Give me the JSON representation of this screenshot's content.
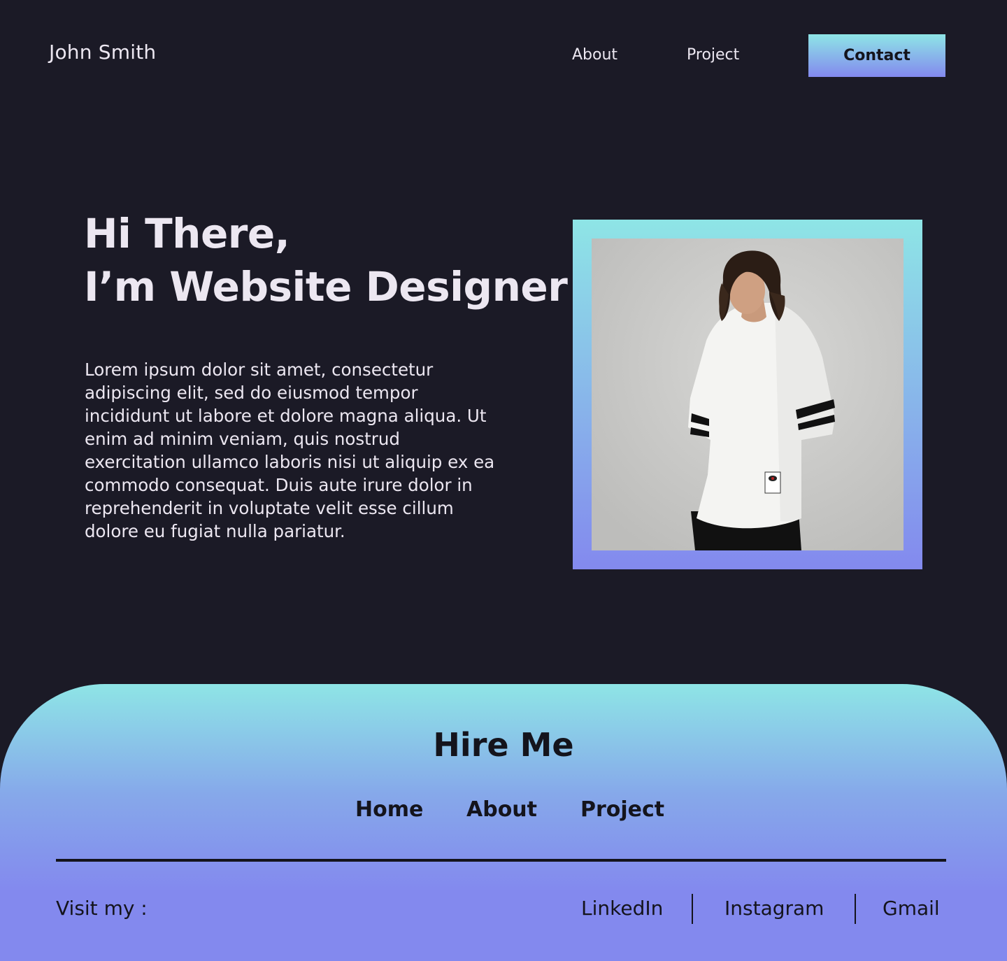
{
  "nav": {
    "logo": "John Smith",
    "about": "About",
    "project": "Project",
    "contact": "Contact"
  },
  "hero": {
    "heading_line1": "Hi There,",
    "heading_line2": "I’m Website Designer",
    "body": "Lorem ipsum dolor sit amet, consectetur adipiscing elit, sed do eiusmod tempor incididunt ut labore et dolore magna aliqua. Ut enim ad minim veniam, quis nostrud exercitation ullamco laboris nisi ut aliquip ex ea commodo consequat. Duis aute irure dolor in reprehenderit in voluptate velit esse cillum dolore eu fugiat nulla pariatur."
  },
  "footer": {
    "title": "Hire Me",
    "links": [
      "Home",
      "About",
      "Project"
    ],
    "visit_label": "Visit my :",
    "socials": [
      "LinkedIn",
      "Instagram",
      "Gmail"
    ]
  },
  "colors": {
    "background": "#1b1a26",
    "text_light": "#ece7f1",
    "gradient_top": "#8ee5e6",
    "gradient_bottom": "#8389ee",
    "text_dark": "#14141c"
  },
  "images": {
    "portrait": "portrait-photo"
  }
}
